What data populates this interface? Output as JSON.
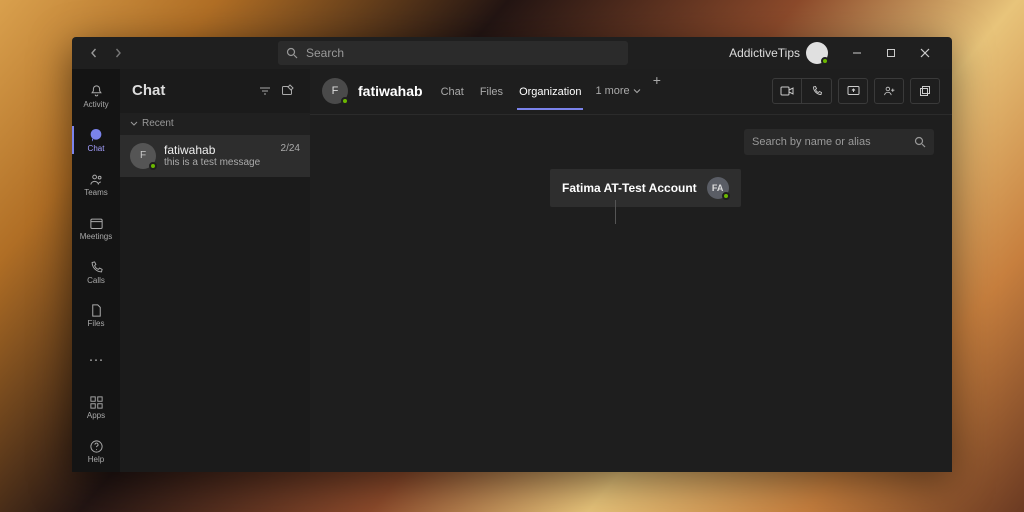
{
  "titlebar": {
    "search_placeholder": "Search",
    "account_name": "AddictiveTips"
  },
  "rail": {
    "items": [
      {
        "label": "Activity",
        "icon": "🔔"
      },
      {
        "label": "Chat",
        "icon": "💬"
      },
      {
        "label": "Teams",
        "icon": "👥"
      },
      {
        "label": "Meetings",
        "icon": "📅"
      },
      {
        "label": "Calls",
        "icon": "📞"
      },
      {
        "label": "Files",
        "icon": "🗎"
      }
    ],
    "more": "···",
    "bottom": [
      {
        "label": "Apps",
        "icon": "⊞"
      },
      {
        "label": "Help",
        "icon": "?"
      }
    ]
  },
  "chatlist": {
    "title": "Chat",
    "section": "Recent",
    "items": [
      {
        "name": "fatiwahab",
        "preview": "this is a test message",
        "date": "2/24",
        "initial": "F"
      }
    ]
  },
  "main": {
    "person": "fatiwahab",
    "initial": "F",
    "tabs": [
      {
        "label": "Chat",
        "active": false
      },
      {
        "label": "Files",
        "active": false
      },
      {
        "label": "Organization",
        "active": true
      }
    ],
    "more_tab": "1 more",
    "filter_placeholder": "Search by name or alias",
    "org_card": {
      "name": "Fatima AT-Test Account",
      "initials": "FA"
    }
  }
}
